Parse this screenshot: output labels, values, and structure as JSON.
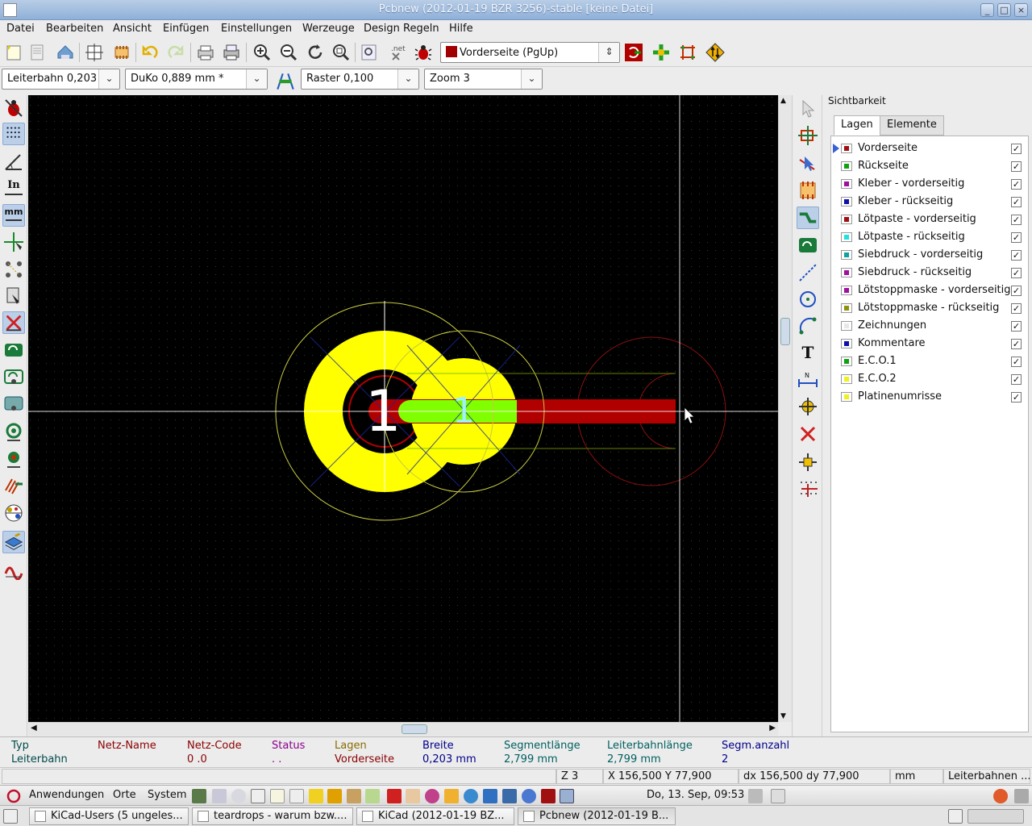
{
  "window": {
    "title": "Pcbnew (2012-01-19 BZR 3256)-stable  [keine Datei]"
  },
  "menu": [
    "Datei",
    "Bearbeiten",
    "Ansicht",
    "Einfügen",
    "Einstellungen",
    "Werzeuge",
    "Design Regeln",
    "Hilfe"
  ],
  "toolbar": {
    "layer_select": "Vorderseite (PgUp)",
    "track_width": "Leiterbahn 0,203",
    "via_size": "DuKo 0,889 mm *",
    "grid": "Raster 0,100",
    "zoom": "Zoom 3",
    "icons": [
      "new-board-icon",
      "open-icon",
      "save-icon",
      "page-settings-icon",
      "module-editor-icon",
      "undo-icon",
      "redo-icon",
      "print-icon",
      "plot-icon",
      "zoom-in-icon",
      "zoom-out-icon",
      "redraw-icon",
      "zoom-fit-icon",
      "find-icon",
      "netlist-icon",
      "drc-icon",
      "layer-color-icon",
      "ratsnest-icon",
      "autoplace-icon",
      "autoroute-icon",
      "mode-icon"
    ]
  },
  "left_toolbar": {
    "icons": [
      "drc-off-icon",
      "grid-icon",
      "polar-coord-icon",
      "unit-inch-icon",
      "unit-mm-icon",
      "cursor-shape-icon",
      "ratsnest-general-icon",
      "ratsnest-module-icon",
      "autodelete-track-icon",
      "zone-fill-icon",
      "zone-outline-icon",
      "zone-sketch-icon",
      "pad-sketch-icon",
      "via-sketch-icon",
      "track-sketch-icon",
      "high-contrast-icon",
      "layers-manager-icon",
      "microwave-tools-icon"
    ],
    "labels": {
      "inch": "In",
      "mm": "mm"
    }
  },
  "right_toolbar": {
    "icons": [
      "select-arrow-icon",
      "add-module-icon",
      "net-highlight-icon",
      "local-ratsnest-icon",
      "add-track-icon",
      "add-zone-icon",
      "add-line-icon",
      "add-circle-icon",
      "add-arc-icon",
      "add-text-icon",
      "add-dimension-icon",
      "add-target-icon",
      "delete-icon",
      "set-origin-icon",
      "grid-origin-icon"
    ],
    "text_tool": "T"
  },
  "visibility": {
    "title": "Sichtbarkeit",
    "tabs": [
      "Lagen",
      "Elemente"
    ],
    "active_tab": "Lagen",
    "layers": [
      {
        "name": "Vorderseite",
        "color": "#a01010",
        "checked": true,
        "current": true
      },
      {
        "name": "Rückseite",
        "color": "#10a010",
        "checked": true
      },
      {
        "name": "Kleber - vorderseitig",
        "color": "#a010a0",
        "checked": true
      },
      {
        "name": "Kleber - rückseitig",
        "color": "#1010a8",
        "checked": true
      },
      {
        "name": "Lötpaste - vorderseitig",
        "color": "#a01010",
        "checked": true
      },
      {
        "name": "Lötpaste - rückseitig",
        "color": "#20e0e0",
        "checked": true
      },
      {
        "name": "Siebdruck - vorderseitig",
        "color": "#10a0a0",
        "checked": true
      },
      {
        "name": "Siebdruck - rückseitig",
        "color": "#a010a0",
        "checked": true
      },
      {
        "name": "Lötstoppmaske - vorderseitig",
        "color": "#a010a0",
        "checked": true
      },
      {
        "name": "Lötstoppmaske - rückseitig",
        "color": "#909010",
        "checked": true
      },
      {
        "name": "Zeichnungen",
        "color": "#e8e8e8",
        "checked": true
      },
      {
        "name": "Kommentare",
        "color": "#1010a8",
        "checked": true
      },
      {
        "name": "E.C.O.1",
        "color": "#10a010",
        "checked": true
      },
      {
        "name": "E.C.O.2",
        "color": "#f0f020",
        "checked": true
      },
      {
        "name": "Platinenumrisse",
        "color": "#f0f020",
        "checked": true
      }
    ]
  },
  "canvas": {
    "pad_label": "1",
    "pad_color": "#ffff00",
    "track_color": "#b00000",
    "highlight_color": "#80ff00"
  },
  "message_panel": {
    "columns": [
      {
        "header": "Typ",
        "value": "Leiterbahn",
        "hcolor": "#004a4a",
        "vcolor": "#004a4a"
      },
      {
        "header": "Netz-Name",
        "value": "",
        "hcolor": "#8b0000",
        "vcolor": "#8b0000"
      },
      {
        "header": "Netz-Code",
        "value": "0 .0",
        "hcolor": "#8b0000",
        "vcolor": "#8b0000"
      },
      {
        "header": "Status",
        "value": ". .",
        "hcolor": "#8b008b",
        "vcolor": "#8b008b"
      },
      {
        "header": "Lagen",
        "value": "Vorderseite",
        "hcolor": "#8b6b00",
        "vcolor": "#8b0000"
      },
      {
        "header": "Breite",
        "value": "0,203 mm",
        "hcolor": "#00008b",
        "vcolor": "#00008b"
      },
      {
        "header": "Segmentlänge",
        "value": "2,799 mm",
        "hcolor": "#006060",
        "vcolor": "#006060"
      },
      {
        "header": "Leiterbahnlänge",
        "value": "2,799 mm",
        "hcolor": "#006060",
        "vcolor": "#006060"
      },
      {
        "header": "Segm.anzahl",
        "value": "2",
        "hcolor": "#00008b",
        "vcolor": "#00008b"
      }
    ]
  },
  "statusbar": {
    "zoom": "Z 3",
    "coords": "X 156,500  Y 77,900",
    "delta": "dx 156,500  dy 77,900",
    "units": "mm",
    "mode": "Leiterbahnen ..."
  },
  "gnome_panel": {
    "menus": [
      "Anwendungen",
      "Orte",
      "System"
    ],
    "clock": "Do, 13. Sep, 09:53"
  },
  "taskbar": {
    "tasks": [
      {
        "label": "KiCad-Users (5 ungeles...",
        "active": false
      },
      {
        "label": "teardrops - warum bzw....",
        "active": false
      },
      {
        "label": "KiCad (2012-01-19 BZ...",
        "active": false
      },
      {
        "label": "Pcbnew (2012-01-19 B...",
        "active": true
      }
    ]
  }
}
